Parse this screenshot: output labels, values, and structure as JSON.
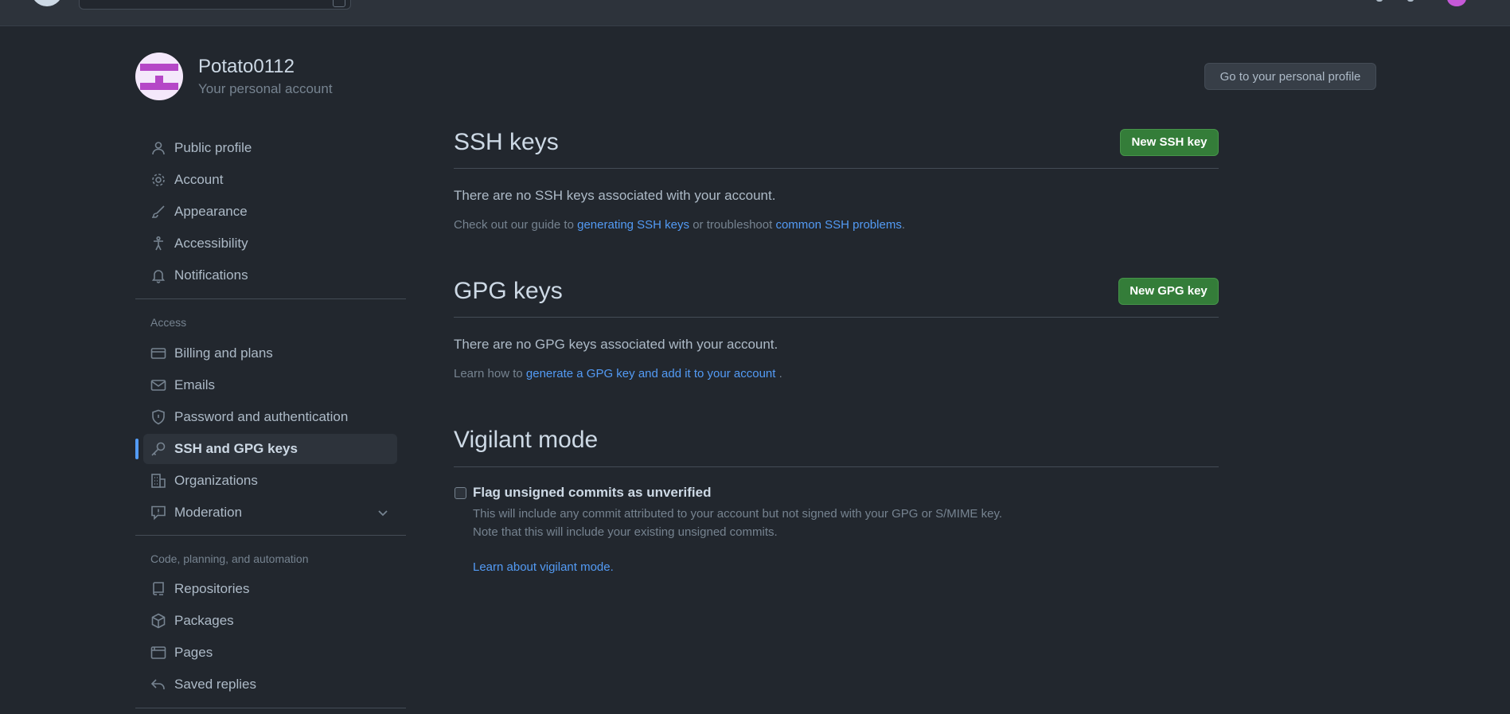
{
  "colors": {
    "background": "#22272e",
    "accent": "#539bf5",
    "button_green": "#347d39"
  },
  "user": {
    "name": "Potato0112",
    "subtitle": "Your personal account",
    "profile_button": "Go to your personal profile"
  },
  "sidebar": {
    "items_top": [
      {
        "label": "Public profile",
        "icon": "person-icon"
      },
      {
        "label": "Account",
        "icon": "gear-icon"
      },
      {
        "label": "Appearance",
        "icon": "paintbrush-icon"
      },
      {
        "label": "Accessibility",
        "icon": "accessibility-icon"
      },
      {
        "label": "Notifications",
        "icon": "bell-icon"
      }
    ],
    "access_label": "Access",
    "items_access": [
      {
        "label": "Billing and plans",
        "icon": "credit-card-icon"
      },
      {
        "label": "Emails",
        "icon": "mail-icon"
      },
      {
        "label": "Password and authentication",
        "icon": "shield-icon"
      },
      {
        "label": "SSH and GPG keys",
        "icon": "key-icon",
        "active": true
      },
      {
        "label": "Organizations",
        "icon": "organization-icon"
      },
      {
        "label": "Moderation",
        "icon": "report-icon"
      }
    ],
    "code_label": "Code, planning, and automation",
    "items_code": [
      {
        "label": "Repositories",
        "icon": "repo-icon"
      },
      {
        "label": "Packages",
        "icon": "package-icon"
      },
      {
        "label": "Pages",
        "icon": "browser-icon"
      },
      {
        "label": "Saved replies",
        "icon": "reply-icon"
      }
    ]
  },
  "ssh": {
    "title": "SSH keys",
    "button": "New SSH key",
    "empty": "There are no SSH keys associated with your account.",
    "note_pre": "Check out our guide to ",
    "note_link1": "generating SSH keys",
    "note_mid": " or troubleshoot ",
    "note_link2": "common SSH problems",
    "note_post": "."
  },
  "gpg": {
    "title": "GPG keys",
    "button": "New GPG key",
    "empty": "There are no GPG keys associated with your account.",
    "note_pre": "Learn how to ",
    "note_link": "generate a GPG key and add it to your account",
    "note_post": " ."
  },
  "vigilant": {
    "title": "Vigilant mode",
    "checkbox_label": "Flag unsigned commits as unverified",
    "checked": false,
    "help1": "This will include any commit attributed to your account but not signed with your GPG or S/MIME key.",
    "help2": "Note that this will include your existing unsigned commits.",
    "learn_link": "Learn about vigilant mode."
  }
}
